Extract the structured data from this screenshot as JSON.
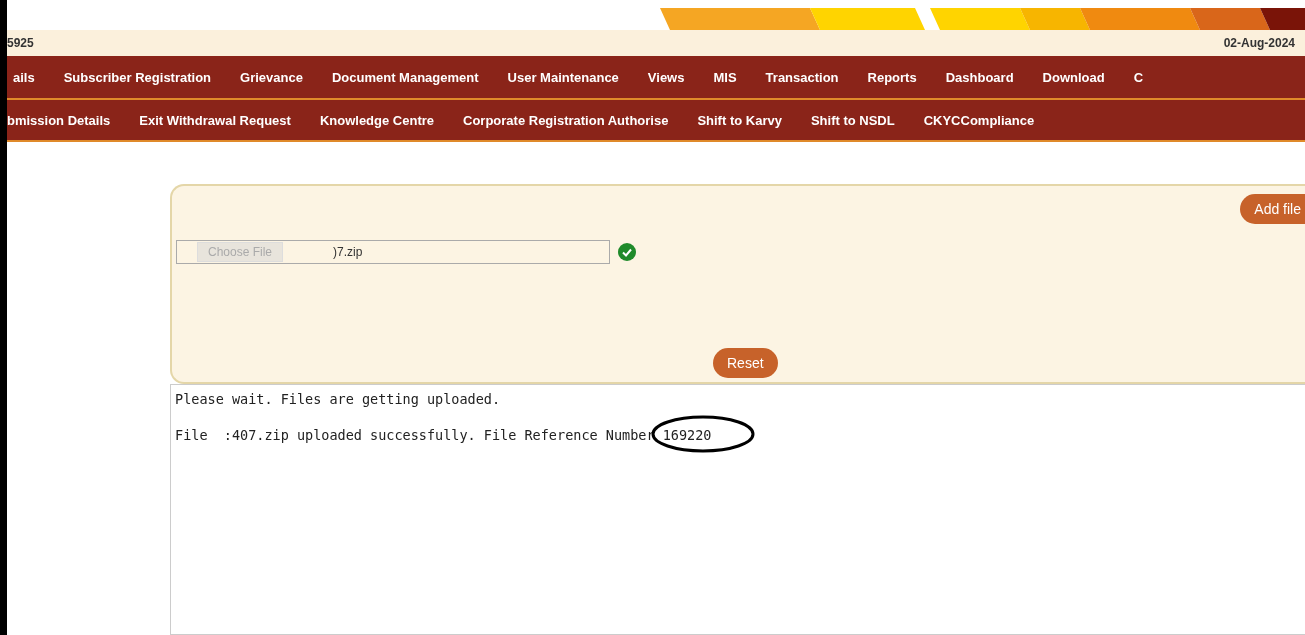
{
  "header": {
    "id_text": "5925",
    "date": "02-Aug-2024"
  },
  "menu_primary": [
    "ails",
    "Subscriber Registration",
    "Grievance",
    "Document Management",
    "User Maintenance",
    "Views",
    "MIS",
    "Transaction",
    "Reports",
    "Dashboard",
    "Download",
    "C"
  ],
  "menu_secondary": [
    "bmission Details",
    "Exit Withdrawal Request",
    "Knowledge Centre",
    "Corporate Registration Authorise",
    "Shift to Karvy",
    "Shift to NSDL",
    "CKYCCompliance"
  ],
  "upload": {
    "add_button": "Add file",
    "choose_button": "Choose File",
    "file_name": ")7.zip",
    "verified": true,
    "reset_button": "Reset"
  },
  "log": {
    "lines": [
      {
        "text": "Please wait. Files are getting uploaded."
      },
      {
        "text": "File  :407.zip uploaded successfully. File Reference Number ",
        "reference": "169220",
        "circled": true
      }
    ]
  }
}
